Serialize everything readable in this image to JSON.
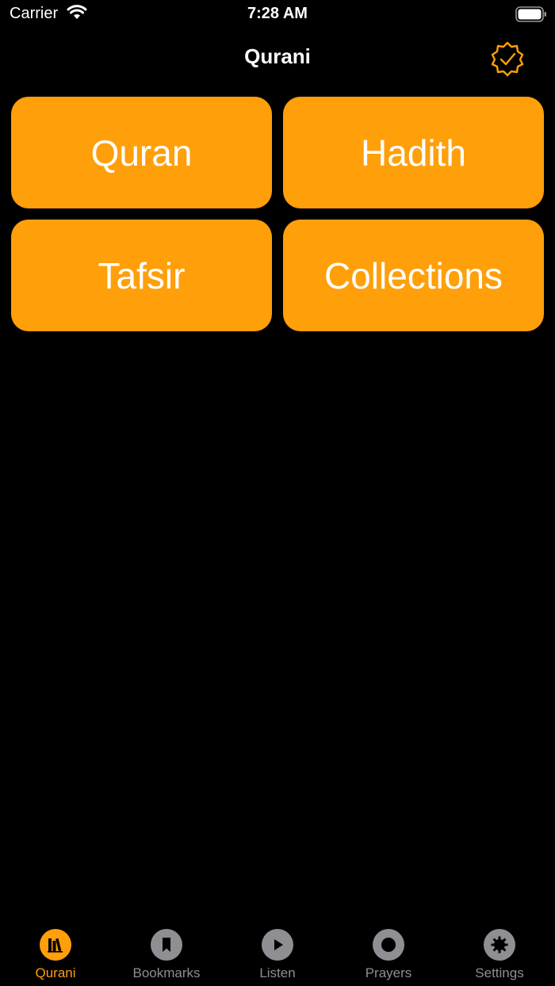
{
  "status_bar": {
    "carrier": "Carrier",
    "time": "7:28 AM",
    "wifi_icon": "wifi-icon",
    "battery_icon": "battery-full-icon"
  },
  "nav": {
    "title": "Qurani",
    "right_icon": "verified-badge-icon"
  },
  "tiles": [
    {
      "label": "Quran"
    },
    {
      "label": "Hadith"
    },
    {
      "label": "Tafsir"
    },
    {
      "label": "Collections"
    }
  ],
  "tab_bar": {
    "active_index": 0,
    "items": [
      {
        "label": "Qurani",
        "icon": "books-icon"
      },
      {
        "label": "Bookmarks",
        "icon": "bookmark-icon"
      },
      {
        "label": "Listen",
        "icon": "play-icon"
      },
      {
        "label": "Prayers",
        "icon": "clock-icon"
      },
      {
        "label": "Settings",
        "icon": "gear-icon"
      }
    ]
  },
  "colors": {
    "accent": "#FF9F0A",
    "inactive": "#8E8E93",
    "background": "#000000",
    "text": "#FFFFFF"
  }
}
